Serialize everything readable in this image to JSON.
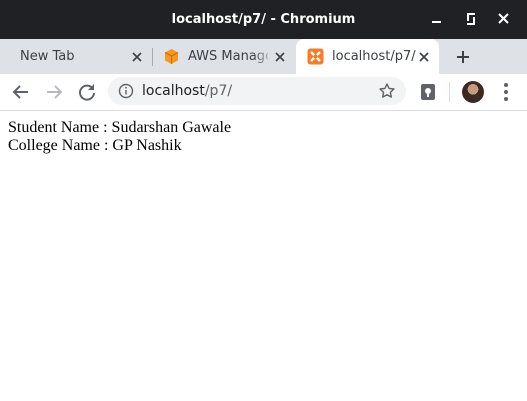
{
  "window": {
    "title": "localhost/p7/ - Chromium"
  },
  "tabs": [
    {
      "label": "New Tab",
      "active": false
    },
    {
      "label": "AWS Management Console",
      "active": false
    },
    {
      "label": "localhost/p7/",
      "active": true
    }
  ],
  "address_bar": {
    "host": "localhost",
    "path": "/p7/"
  },
  "page": {
    "student_label": "Student Name : Sudarshan Gawale",
    "college_label": "College Name : GP Nashik"
  },
  "colors": {
    "titlebar": "#202124",
    "tabstrip": "#dee1e6",
    "aws_orange": "#f7981f",
    "xampp_orange": "#fb7a24"
  }
}
